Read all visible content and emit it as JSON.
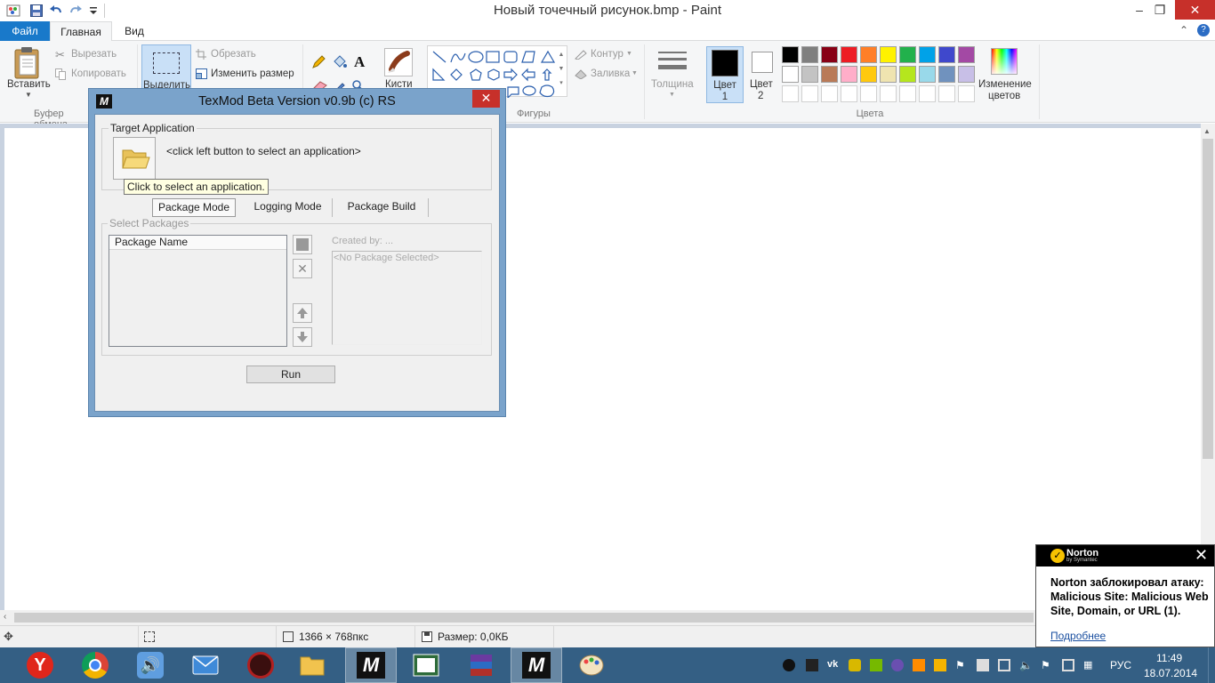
{
  "window": {
    "title": "Новый точечный рисунок.bmp - Paint",
    "minimize": "–",
    "maximize": "❐",
    "close": "✕"
  },
  "tabs": {
    "file": "Файл",
    "home": "Главная",
    "view": "Вид"
  },
  "ribbon": {
    "clipboard": {
      "paste": "Вставить",
      "cut": "Вырезать",
      "copy": "Копировать",
      "group": "Буфер обмена"
    },
    "image": {
      "select": "Выделить",
      "crop": "Обрезать",
      "resize": "Изменить размер"
    },
    "brushes": "Кисти",
    "shapes": {
      "outline": "Контур",
      "fill": "Заливка",
      "group": "Фигуры"
    },
    "size": "Толщина",
    "colors": {
      "color1": "Цвет 1",
      "color1_a": "Цвет",
      "color1_b": "1",
      "color2_a": "Цвет",
      "color2_b": "2",
      "edit_a": "Изменение",
      "edit_b": "цветов",
      "group": "Цвета",
      "row1": [
        "#000000",
        "#7f7f7f",
        "#880015",
        "#ed1c24",
        "#ff7f27",
        "#fff200",
        "#22b14c",
        "#00a2e8",
        "#3f48cc",
        "#a349a4"
      ],
      "row2": [
        "#ffffff",
        "#c3c3c3",
        "#b97a57",
        "#ffaec9",
        "#ffc90e",
        "#efe4b0",
        "#b5e61d",
        "#99d9ea",
        "#7092be",
        "#c8bfe7"
      ]
    }
  },
  "dialog": {
    "title": "TexMod Beta Version v0.9b (c) RS",
    "close": "✕",
    "target_legend": "Target Application",
    "target_hint": "<click left button to select an application>",
    "tooltip": "Click to select an application.",
    "modes": [
      "Package Mode",
      "Logging Mode",
      "Package Build"
    ],
    "select_legend": "Select Packages",
    "column": "Package Name",
    "created_by": "Created by: ...",
    "no_package": "<No Package Selected>",
    "run": "Run"
  },
  "status": {
    "dimensions": "1366 × 768пкс",
    "size": "Размер: 0,0КБ"
  },
  "norton": {
    "brand": "Norton",
    "brand_sub": "by Symantec",
    "message": "Norton заблокировал атаку: Malicious Site: Malicious Web Site, Domain, or URL (1).",
    "link": "Подробнее"
  },
  "taskbar": {
    "apps": [
      "yandex-browser",
      "chrome",
      "speaker-app",
      "mail",
      "game-app",
      "file-explorer",
      "texmod",
      "reader-app",
      "winrar",
      "texmod-active",
      "paint"
    ],
    "language": "РУС",
    "time": "11:49",
    "date": "18.07.2014"
  }
}
